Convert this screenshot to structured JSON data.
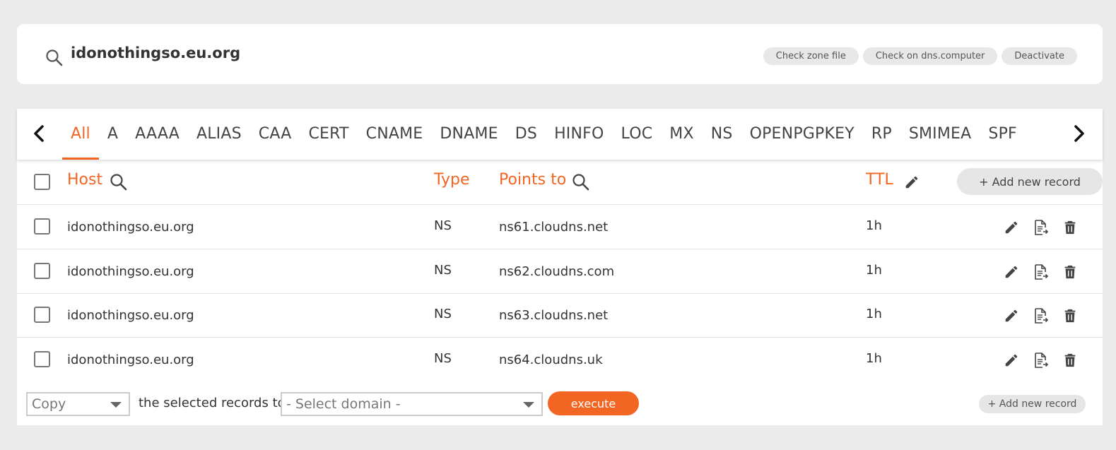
{
  "domain": {
    "name": "idonothingso.eu.org",
    "buttons": [
      "Check zone file",
      "Check on dns.computer",
      "Deactivate"
    ]
  },
  "tabs": [
    "All",
    "A",
    "AAAA",
    "ALIAS",
    "CAA",
    "CERT",
    "CNAME",
    "DNAME",
    "DS",
    "HINFO",
    "LOC",
    "MX",
    "NS",
    "OPENPGPKEY",
    "RP",
    "SMIMEA",
    "SPF"
  ],
  "active_tab": "All",
  "table": {
    "headers": {
      "host": "Host",
      "type": "Type",
      "points_to": "Points to",
      "ttl": "TTL"
    },
    "add_record_label": "+ Add new record",
    "rows": [
      {
        "host": "idonothingso.eu.org",
        "type": "NS",
        "points_to": "ns61.cloudns.net",
        "ttl": "1h"
      },
      {
        "host": "idonothingso.eu.org",
        "type": "NS",
        "points_to": "ns62.cloudns.com",
        "ttl": "1h"
      },
      {
        "host": "idonothingso.eu.org",
        "type": "NS",
        "points_to": "ns63.cloudns.net",
        "ttl": "1h"
      },
      {
        "host": "idonothingso.eu.org",
        "type": "NS",
        "points_to": "ns64.cloudns.uk",
        "ttl": "1h"
      }
    ]
  },
  "bottom": {
    "action_select": "Copy",
    "selected_text": "the selected records to",
    "domain_select": "- Select domain -",
    "execute_label": "execute",
    "add_record_label": "+ Add new record"
  },
  "colors": {
    "accent": "#f26522",
    "background": "#ebebeb"
  },
  "icons": [
    "search-icon",
    "chevron-left-icon",
    "chevron-right-icon",
    "pencil-icon",
    "document-export-icon",
    "trash-icon"
  ]
}
